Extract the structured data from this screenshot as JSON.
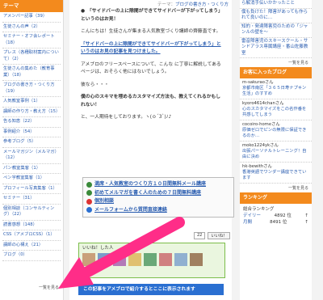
{
  "left_sidebar": {
    "heading": "テーマ",
    "items": [
      "アメンバー記事（39）",
      "生徒さんの声（2）",
      "セミナー・オフ会レポート（18）",
      "プレス（各種取材案内について）（2）",
      "生徒さんの集めた（教育事業）（18）",
      "ブログの書き方・つくり方（19）",
      "人気教室事例（1）",
      "講師の作り方・教え方（15）",
      "告る知恵（22）",
      "事例紹介（54）",
      "参考ブログ（5）",
      "メールマガジン（メルマガ）（12）",
      "パン教室集客（1）",
      "ペン字教室集客（1）",
      "プロフィール写真集客（1）",
      "セミナー（31）",
      "個別相談（コンサルティング）（22）",
      "読書感想（148）",
      "CSS（アメブロCSS）（1）",
      "講師の心構え（21）",
      "ブログ（0）"
    ],
    "more": "一覧を見る"
  },
  "main": {
    "theme_label": "テーマ：",
    "theme_value": "ブログの書き方・つくり方",
    "heading_line": "●　「サイドバーの上に隙間ができてサイドバーが下がってしまう」というのはお見！",
    "p1": "こんにちは！生徒さんが集まる人気教室づくり講師の齊藤直です。",
    "link_title": "「サイドバーの上に隙間ができてサイドバーが下がってしまう」というのはお見の記事を見つけました。",
    "p2": "アメブロのフリースペースについて、こんな に丁寧に解説してあるページは、おそらく他にはないでしょう。",
    "p3": "彼なら・・・",
    "p4": "僕の心のスキマを埋めるカスタマイズ方法も、教えてくれるかもしれない！",
    "p5": "と、一人期待をしております。ヽ(ｏ´3`)ﾉ♪",
    "boxes": [
      {
        "icon": "green-circle-icon",
        "text": "満席・人気教室のつくり方１０日間無料メール講座"
      },
      {
        "icon": "green-circle-icon",
        "text": "初めてメルマガを書く人のための７日間無料講座"
      },
      {
        "icon": "red-circle-icon",
        "text": "個別相談"
      },
      {
        "icon": "blue-circle-icon",
        "text": "メールフォームから質問直接連絡"
      }
    ],
    "like_count": "22",
    "like_button": "いいね！",
    "likers_heading": "いいね！した人",
    "share_text": "この記事をアメブロで紹介するとここに表示されます"
  },
  "right_sidebar": {
    "top_links": [
      "ら解消手伝いかかったこと",
      "僕も負けた！障害があっても作られて良いのに…",
      "知的・発達障害児のための「ジャンルの壁を〜",
      "雷音障害児のスキースクール・サンドアラス専属講座・番山佐藤教室"
    ],
    "more1": "一覧を見る",
    "heading_comments": "お客に入ったブログ",
    "comments": [
      {
        "who": "m-sakuraoさん",
        "text": "京都市南区「３６５日寿ナプキン生活」のすすめ"
      },
      {
        "who": "kyoro4614chanさん",
        "text": "心のスカタマイズをこの名作番を共感してしまう"
      },
      {
        "who": "cocoiro-homeさん",
        "text": "原価ゼロでピンの無限に保証できるのか…"
      },
      {
        "who": "moko1224ykさん",
        "text": "出張パーソナルトレーニング！自由に決め"
      },
      {
        "who": "hk-bewithさん",
        "text": "香港英語でワンダー講座できています"
      }
    ],
    "more2": "一覧を見る",
    "heading_ranking": "ランキング",
    "ranking_title": "総合ランキング",
    "ranking_rows": [
      {
        "label": "デイリー",
        "value": "4892 位",
        "arrow": "↑"
      },
      {
        "label": "月間",
        "value": "8491 位",
        "arrow": "↑"
      }
    ]
  },
  "colors": {
    "accent": "#f38a1d",
    "link": "#2a5db0",
    "arrow": "#ff2d88"
  }
}
